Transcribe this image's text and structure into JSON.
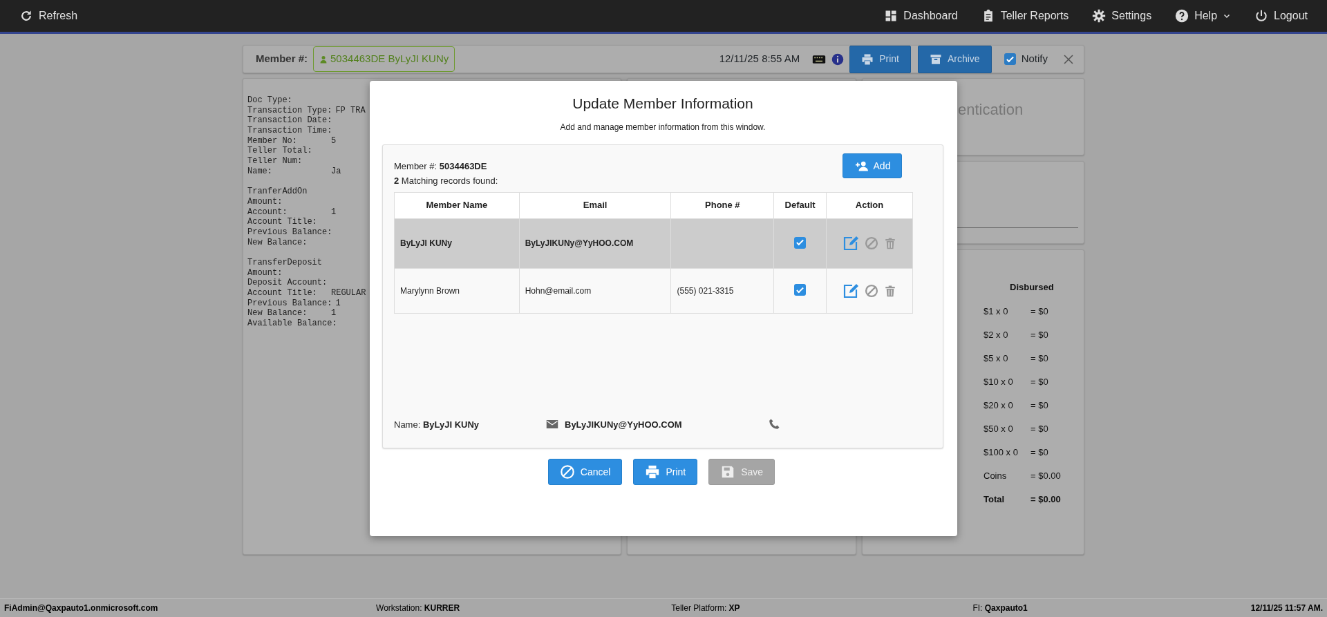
{
  "navbar": {
    "left": [
      {
        "label": "Refresh"
      }
    ],
    "right": [
      {
        "label": "Dashboard",
        "dropdown": false
      },
      {
        "label": "Teller Reports",
        "dropdown": false
      },
      {
        "label": "Settings",
        "dropdown": false
      },
      {
        "label": "Help",
        "dropdown": true
      },
      {
        "label": "Logout",
        "dropdown": false
      }
    ]
  },
  "member_bar": {
    "label": "Member #:",
    "member_badge": "5034463DE ByLyJI KUNy",
    "datetime": "12/11/25 8:55 AM",
    "buttons": [
      "Print",
      "Archive"
    ],
    "notify": {
      "label": "Notify",
      "checked": true
    }
  },
  "receipt": {
    "sections": [
      {
        "lines": [
          {
            "label": "Doc Type:"
          },
          {
            "label": "Transaction Type:",
            "value": "FP TRA"
          },
          {
            "label": "Transaction Date:"
          },
          {
            "label": "Transaction Time:"
          },
          {
            "label": "Member No:",
            "value": "5"
          },
          {
            "label": "Teller Total:"
          },
          {
            "label": "Teller Num:"
          },
          {
            "label": "Name:",
            "value": "Ja"
          }
        ]
      },
      {
        "title": "TranferAddOn",
        "lines": [
          {
            "label": "Amount:"
          },
          {
            "label": "Account:",
            "value": "1"
          },
          {
            "label": "Account Title:"
          },
          {
            "label": "Previous Balance:"
          },
          {
            "label": "New Balance:"
          }
        ]
      },
      {
        "title": "TransferDeposit",
        "lines": [
          {
            "label": "Amount:"
          },
          {
            "label": "Deposit Account:"
          },
          {
            "label": "Account Title:",
            "value": "REGULAR"
          },
          {
            "label": "Previous Balance:",
            "value": "1"
          },
          {
            "label": "New Balance:",
            "value": "1"
          },
          {
            "label": "Available Balance:"
          }
        ]
      }
    ]
  },
  "auth_panel": {
    "title": "entication"
  },
  "disbursed": {
    "title": "Disbursed",
    "rows": [
      {
        "kind": "item",
        "denomination": "$1 x 0",
        "amount": "= $0"
      },
      {
        "kind": "item",
        "denomination": "$2 x 0",
        "amount": "= $0"
      },
      {
        "kind": "item",
        "denomination": "$5 x 0",
        "amount": "= $0"
      },
      {
        "kind": "item",
        "denomination": "$10 x 0",
        "amount": "= $0"
      },
      {
        "kind": "item",
        "denomination": "$20 x 0",
        "amount": "= $0"
      },
      {
        "kind": "item",
        "denomination": "$50 x 0",
        "amount": "= $0"
      },
      {
        "kind": "item",
        "denomination": "$100 x 0",
        "amount": "= $0"
      },
      {
        "kind": "item",
        "denomination": "Coins",
        "amount": "= $0.00"
      },
      {
        "kind": "total",
        "denomination": "Total",
        "amount": "= $0.00"
      }
    ]
  },
  "modal": {
    "title": "Update Member Information",
    "subtitle": "Add and manage member information from this window.",
    "member_number": "Member #: **5034463DE**",
    "add_button": "Add",
    "match_text": "**2** Matching records found:",
    "table": {
      "columns": [
        "Member Name",
        "Email",
        "Phone #",
        "Default",
        "Action"
      ],
      "rows": [
        {
          "name": "ByLyJI KUNy",
          "email": "ByLyJIKUNy@YyHOO.COM",
          "default": true,
          "selected": true
        },
        {
          "name": "Marylynn Brown",
          "email": "Hohn@email.com",
          "phone": "(555) 021-3315",
          "default": true,
          "selected": false
        }
      ]
    },
    "summary": {
      "name": "Name: **ByLyJI KUNy**",
      "email": "ByLyJIKUNy@YyHOO.COM"
    },
    "buttons": [
      {
        "label": "Cancel",
        "disabled": false
      },
      {
        "label": "Print",
        "disabled": false
      },
      {
        "label": "Save",
        "disabled": true
      }
    ]
  },
  "status_bar": {
    "items": [
      "**FiAdmin@Qaxpauto1.onmicrosoft.com**",
      "Workstation: **KURRER**",
      "Teller Platform: **XP**",
      "FI: **Qaxpauto1**",
      "**12/11/25 11:57 AM.**"
    ]
  }
}
